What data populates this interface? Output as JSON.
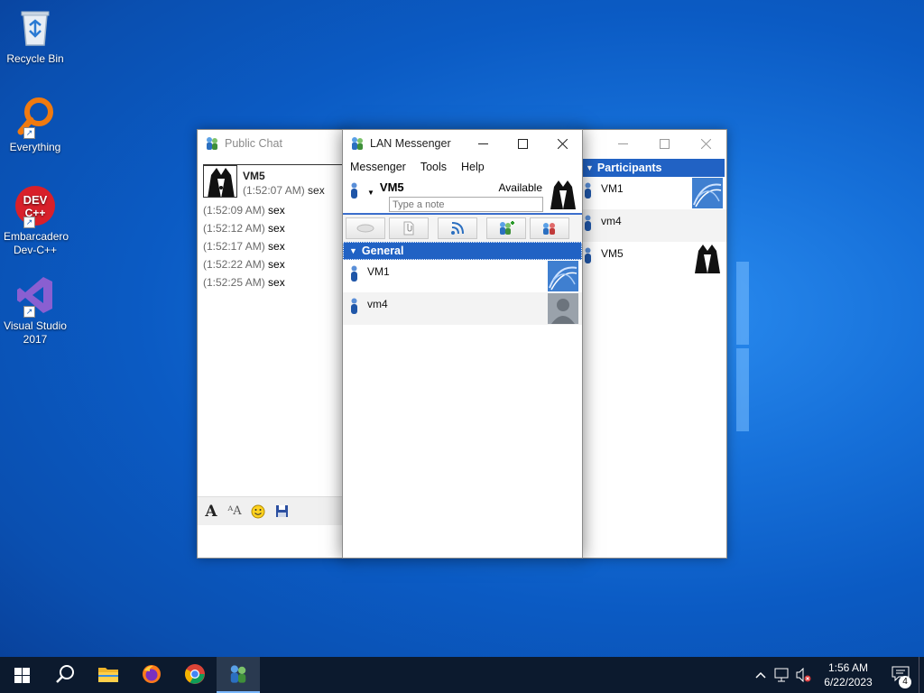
{
  "desktop": {
    "icons": [
      {
        "label": "Recycle Bin"
      },
      {
        "label": "Everything"
      },
      {
        "label": "Embarcadero Dev-C++"
      },
      {
        "label": "Visual Studio 2017"
      }
    ]
  },
  "public_chat": {
    "title": "Public Chat",
    "first_sender": "VM5",
    "messages": [
      {
        "time": "(1:52:07 AM)",
        "text": "sex"
      },
      {
        "time": "(1:52:09 AM)",
        "text": "sex"
      },
      {
        "time": "(1:52:12 AM)",
        "text": "sex"
      },
      {
        "time": "(1:52:17 AM)",
        "text": "sex"
      },
      {
        "time": "(1:52:22 AM)",
        "text": "sex"
      },
      {
        "time": "(1:52:25 AM)",
        "text": "sex"
      }
    ]
  },
  "lan_messenger": {
    "title": "LAN Messenger",
    "menu": {
      "messenger": "Messenger",
      "tools": "Tools",
      "help": "Help"
    },
    "user": {
      "name": "VM5",
      "status": "Available",
      "note_placeholder": "Type a note"
    },
    "group": {
      "name": "General"
    },
    "contacts": [
      {
        "name": "VM1"
      },
      {
        "name": "vm4"
      }
    ]
  },
  "participants": {
    "header": "Participants",
    "items": [
      {
        "name": "VM1"
      },
      {
        "name": "vm4"
      },
      {
        "name": "VM5"
      }
    ]
  },
  "taskbar": {
    "time": "1:56 AM",
    "date": "6/22/2023",
    "notification_count": "4"
  },
  "colors": {
    "accent_blue": "#2162c4",
    "taskbar": "#0c1a2e"
  }
}
